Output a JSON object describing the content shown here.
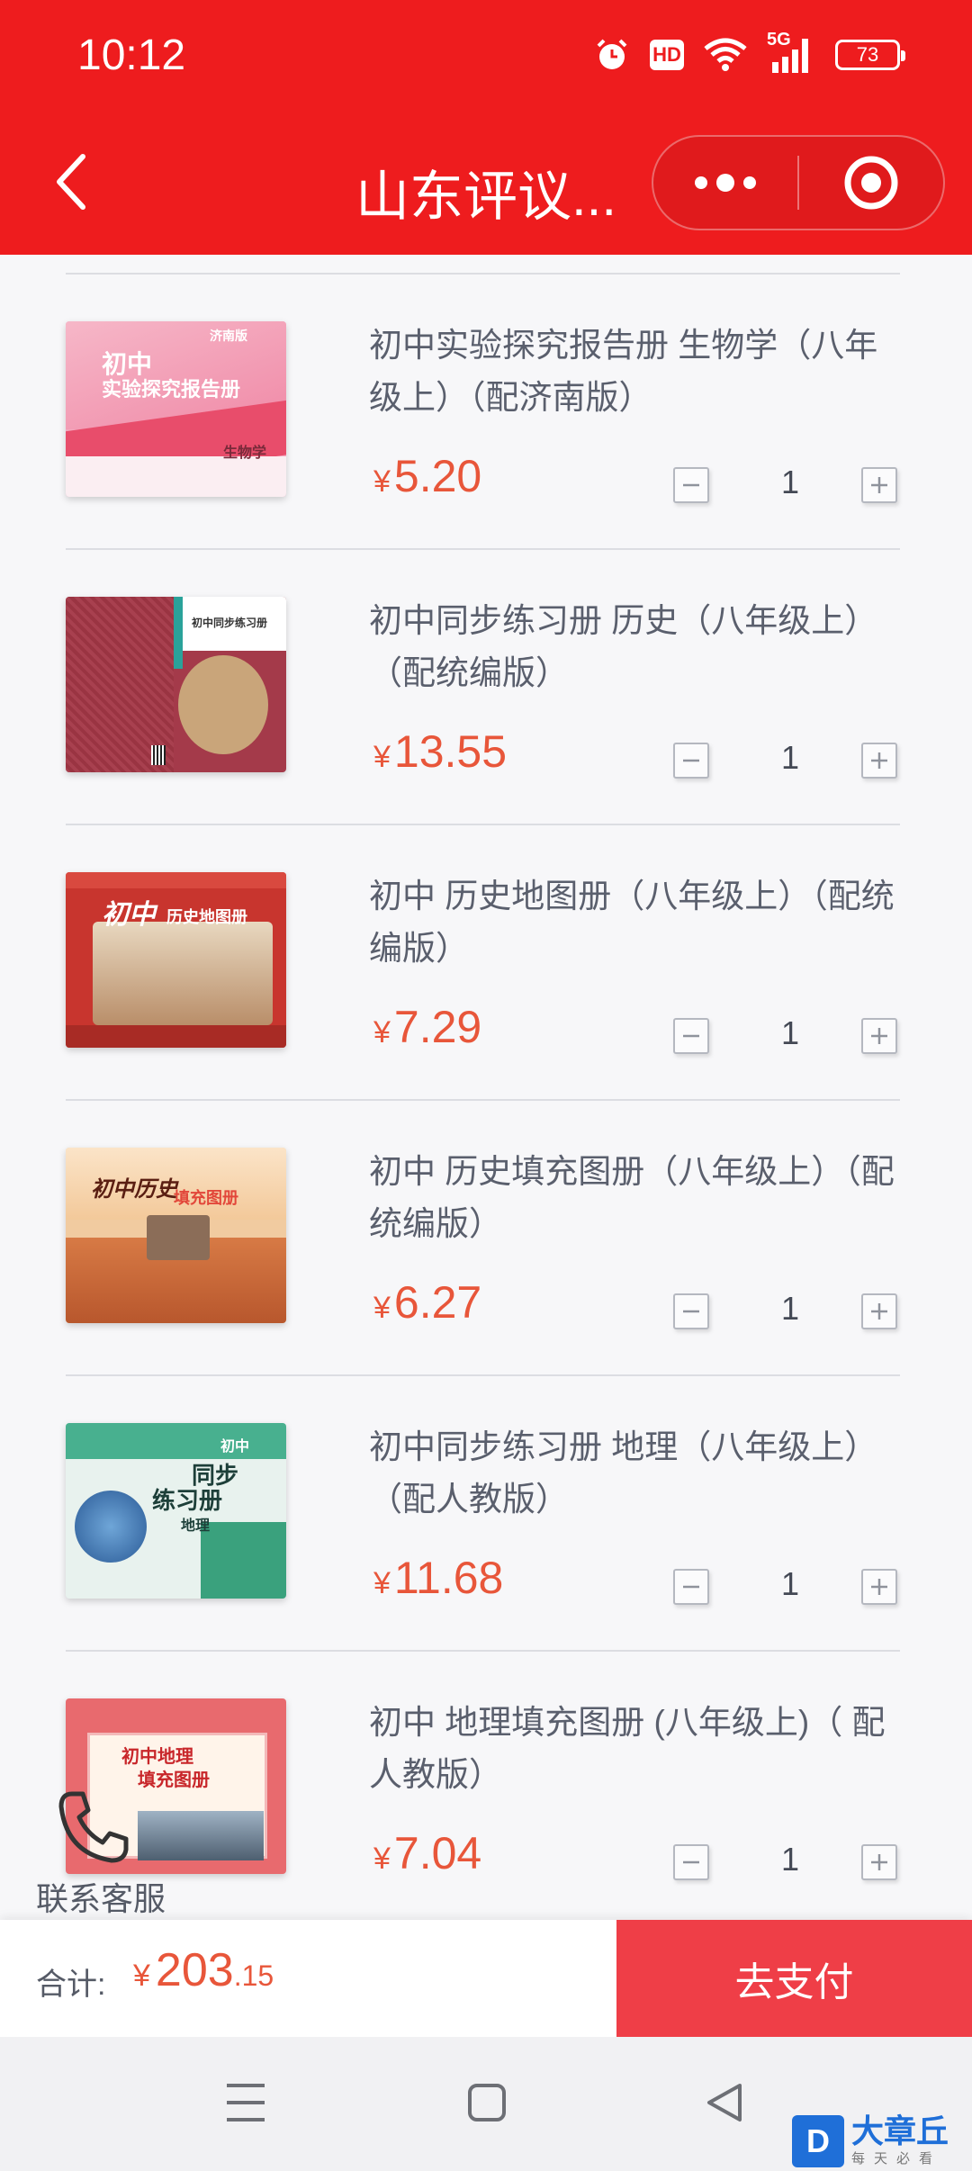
{
  "status_bar": {
    "time": "10:12",
    "hd": "HD",
    "network": "5G",
    "battery": "73"
  },
  "nav": {
    "title": "山东评议...",
    "back_icon": "chevron-left-icon",
    "more_icon": "more-dots-icon",
    "close_icon": "target-circle-icon"
  },
  "currency": "¥",
  "products": [
    {
      "title": "初中实验探究报告册 生物学（八年级上）（配济南版）",
      "price": "5.20",
      "qty": "1"
    },
    {
      "title": "初中同步练习册 历史（八年级上）（配统编版）",
      "price": "13.55",
      "qty": "1"
    },
    {
      "title": "初中 历史地图册（八年级上）（配统编版）",
      "price": "7.29",
      "qty": "1"
    },
    {
      "title": "初中 历史填充图册（八年级上）（配统编版）",
      "price": "6.27",
      "qty": "1"
    },
    {
      "title": "初中同步练习册 地理（八年级上）（配人教版）",
      "price": "11.68",
      "qty": "1"
    },
    {
      "title": "初中 地理填充图册 (八年级上)（ 配人教版）",
      "price": "7.04",
      "qty": "1"
    }
  ],
  "covers": [
    {
      "brand": "济南版",
      "line1": "初中",
      "line2": "实验探究报告册",
      "subject": "生物学"
    },
    {
      "line1": "初中同步练习册"
    },
    {
      "line1": "初中",
      "line2": "历史地图册"
    },
    {
      "line1": "初中历史",
      "line2": "填充图册"
    },
    {
      "line1": "初中",
      "line2": "同步",
      "line3": "练习册",
      "subject": "地理"
    },
    {
      "line1": "初中地理",
      "line2": "填充图册"
    }
  ],
  "service": {
    "label": "联系客服"
  },
  "checkout": {
    "total_label": "合计:",
    "total_int": "203",
    "total_dec": ".15",
    "pay_label": "去支付"
  },
  "watermark": {
    "logo": "D",
    "main": "大章丘",
    "sub": "每天必看"
  },
  "colors": {
    "header": "#ee1c1e",
    "price": "#e8563a",
    "pay_button": "#ef3e47"
  }
}
